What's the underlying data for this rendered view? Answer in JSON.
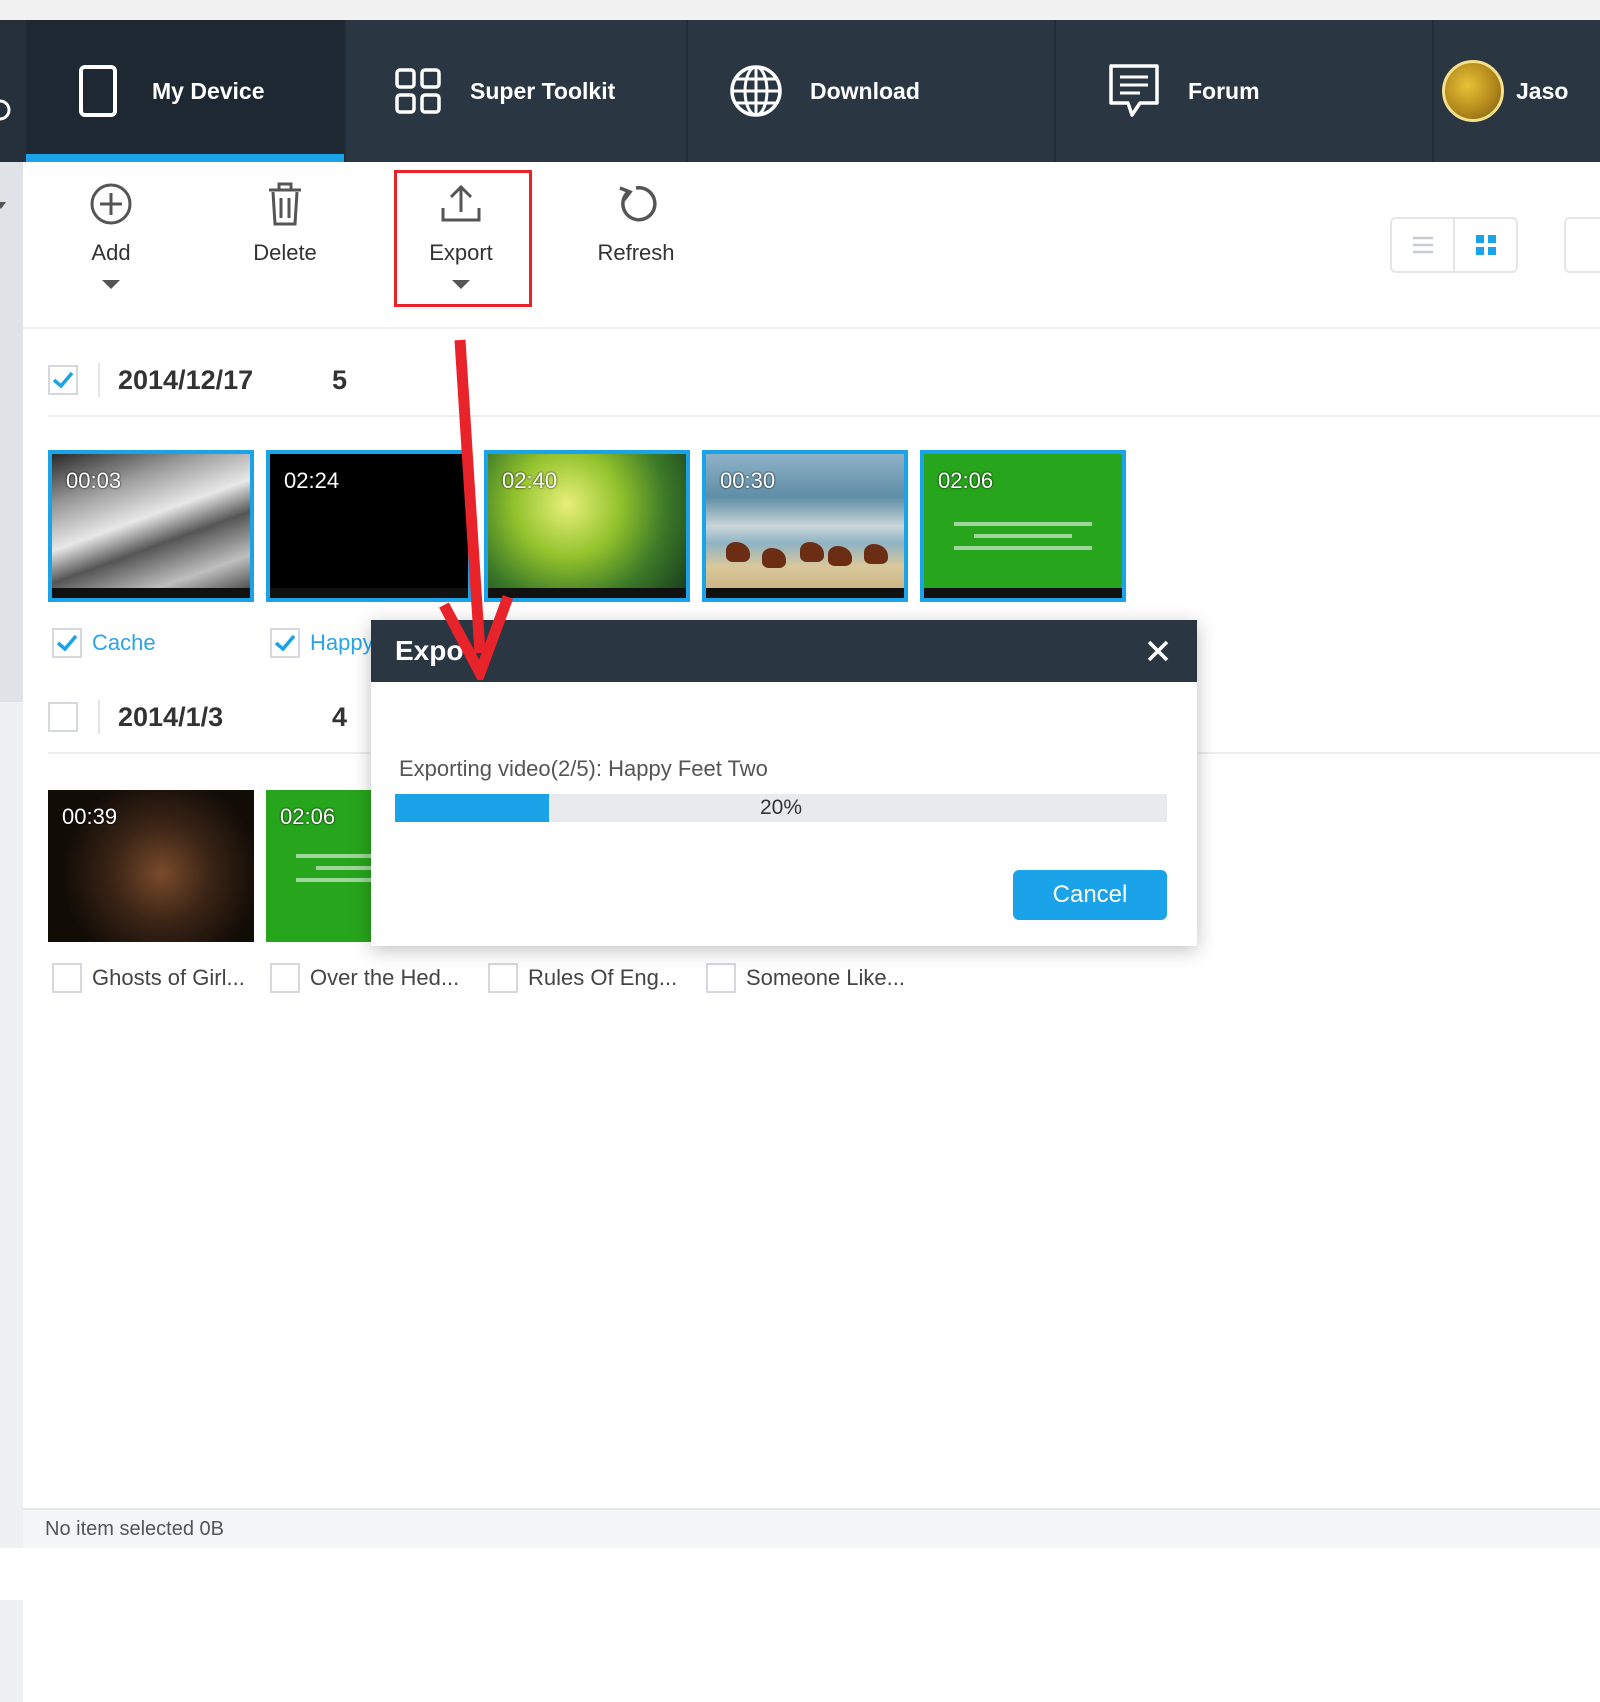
{
  "nav": {
    "tabs": [
      {
        "label": "My Device",
        "icon": "phone-icon",
        "active": true
      },
      {
        "label": "Super Toolkit",
        "icon": "grid-icon",
        "active": false
      },
      {
        "label": "Download",
        "icon": "globe-icon",
        "active": false
      },
      {
        "label": "Forum",
        "icon": "chat-icon",
        "active": false
      }
    ],
    "user_name": "Jaso"
  },
  "toolbar": {
    "add_label": "Add",
    "delete_label": "Delete",
    "export_label": "Export",
    "refresh_label": "Refresh"
  },
  "groups": [
    {
      "date": "2014/12/17",
      "count": "5",
      "checked": true,
      "videos": [
        {
          "duration": "00:03",
          "title": "Cache",
          "checked": true
        },
        {
          "duration": "02:24",
          "title": "Happy",
          "checked": true
        },
        {
          "duration": "02:40",
          "title": "",
          "checked": true
        },
        {
          "duration": "00:30",
          "title": "",
          "checked": true
        },
        {
          "duration": "02:06",
          "title": "",
          "checked": true
        }
      ]
    },
    {
      "date": "2014/1/3",
      "count": "4",
      "checked": false,
      "videos": [
        {
          "duration": "00:39",
          "title": "Ghosts of Girl...",
          "checked": false
        },
        {
          "duration": "02:06",
          "title": "Over the Hed...",
          "checked": false
        },
        {
          "duration": "",
          "title": "Rules Of Eng...",
          "checked": false
        },
        {
          "duration": "",
          "title": "Someone Like...",
          "checked": false
        }
      ]
    }
  ],
  "dialog": {
    "title": "Expo",
    "message": "Exporting video(2/5): Happy Feet Two",
    "progress_percent": 20,
    "progress_text": "20%",
    "cancel_label": "Cancel"
  },
  "status": {
    "text": "No item selected 0B"
  },
  "colors": {
    "nav_bg": "#2b3643",
    "accent": "#1aa3e8",
    "highlight": "#e8242a"
  }
}
